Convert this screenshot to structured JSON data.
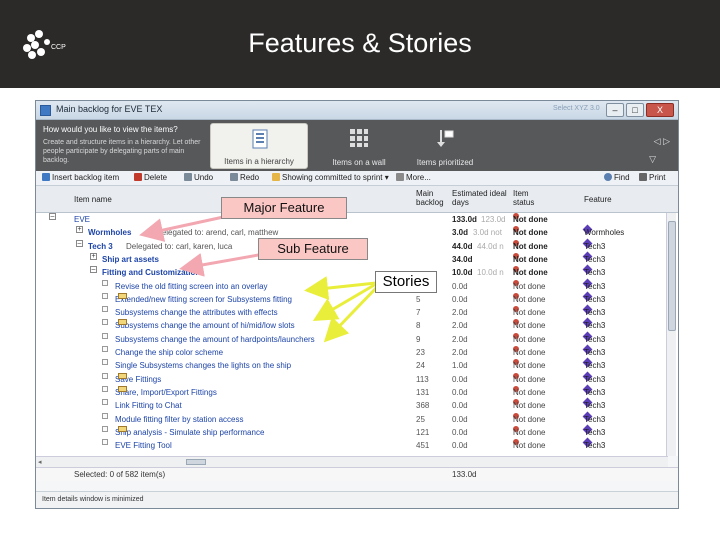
{
  "slide": {
    "title": "Features & Stories",
    "logo_text": "CCP",
    "banner_color": "#2b2a28"
  },
  "window": {
    "title": "Main backlog for EVE TEX",
    "faded_title": "Select XYZ 3.0",
    "buttons": [
      "–",
      "□",
      "X"
    ]
  },
  "view_panel": {
    "question": "How would you like to view the items?",
    "description": "Create and structure items in a hierarchy. Let other people participate by delegating parts of main backlog.",
    "options": [
      {
        "label": "Items in a hierarchy",
        "icon": "hierarchy-icon",
        "selected": true
      },
      {
        "label": "Items on a wall",
        "icon": "wall-grid-icon",
        "selected": false
      },
      {
        "label": "Items prioritized",
        "icon": "prioritized-icon",
        "selected": false
      }
    ],
    "nav": "◁ ▷",
    "more": "▽"
  },
  "toolbar": {
    "insert": "Insert backlog item",
    "delete": "Delete",
    "undo": "Undo",
    "redo": "Redo",
    "showing": "Showing committed to sprint",
    "more": "More...",
    "find": "Find",
    "print": "Print"
  },
  "columns": {
    "name": "Item name",
    "main_backlog": "Main backlog",
    "estimated": "Estimated ideal days",
    "status": "Item status",
    "feature": "Feature"
  },
  "rows": [
    {
      "toggle": "–",
      "name": "EVE",
      "num": "",
      "est": "133.0d",
      "est2": "123.0d",
      "status": "Not done",
      "feature": ""
    },
    {
      "toggle": "+",
      "name": "Wormholes",
      "note": "Delegated to: arend, carl, matthew",
      "num": "",
      "est": "3.0d",
      "est2": "3.0d not",
      "status": "Not done",
      "feature": "Wormholes"
    },
    {
      "toggle": "–",
      "name": "Tech 3",
      "note": "Delegated to: carl, karen, luca",
      "num": "",
      "est": "44.0d",
      "est2": "44.0d n",
      "status": "Not done",
      "feature": "Tech3"
    },
    {
      "toggle": "+",
      "name": "Ship art assets",
      "num": "",
      "est": "34.0d",
      "est2": "",
      "status": "Not done",
      "feature": "Tech3"
    },
    {
      "toggle": "–",
      "name": "Fitting and Customization",
      "num": "",
      "est": "10.0d",
      "est2": "10.0d n",
      "status": "Not done",
      "feature": "Tech3"
    },
    {
      "name": "Revise the old fitting screen into an overlay",
      "num": "",
      "est": "0.0d",
      "status": "Not done",
      "feature": "Tech3"
    },
    {
      "name": "Extended/new fitting screen for Subsystems fitting",
      "mail": true,
      "num": "5",
      "est": "0.0d",
      "status": "Not done",
      "feature": "Tech3"
    },
    {
      "name": "Subsystems change the attributes with effects",
      "num": "7",
      "est": "2.0d",
      "status": "Not done",
      "feature": "Tech3"
    },
    {
      "name": "Subsystems change the amount of hi/mid/low slots",
      "mail": true,
      "num": "8",
      "est": "2.0d",
      "status": "Not done",
      "feature": "Tech3"
    },
    {
      "name": "Subsystems change the amount of hardpoints/launchers",
      "num": "9",
      "est": "2.0d",
      "status": "Not done",
      "feature": "Tech3"
    },
    {
      "name": "Change the ship color scheme",
      "num": "23",
      "est": "2.0d",
      "status": "Not done",
      "feature": "Tech3"
    },
    {
      "name": "Single Subsystems changes the lights on the ship",
      "num": "24",
      "est": "1.0d",
      "status": "Not done",
      "feature": "Tech3"
    },
    {
      "name": "Save Fittings",
      "mail": true,
      "num": "113",
      "est": "0.0d",
      "status": "Not done",
      "feature": "Tech3"
    },
    {
      "name": "Share, Import/Export Fittings",
      "mail": true,
      "num": "131",
      "est": "0.0d",
      "status": "Not done",
      "feature": "Tech3"
    },
    {
      "name": "Link Fitting to Chat",
      "num": "368",
      "est": "0.0d",
      "status": "Not done",
      "feature": "Tech3"
    },
    {
      "name": "Module fitting filter by station access",
      "num": "25",
      "est": "0.0d",
      "status": "Not done",
      "feature": "Tech3"
    },
    {
      "name": "Ship analysis - Simulate ship performance",
      "mail": true,
      "num": "121",
      "est": "0.0d",
      "status": "Not done",
      "feature": "Tech3"
    },
    {
      "name": "EVE Fitting Tool",
      "num": "451",
      "est": "0.0d",
      "status": "Not done",
      "feature": "Tech3"
    }
  ],
  "summary": {
    "selected": "Selected: 0 of 582 item(s)",
    "total": "133.0d"
  },
  "statusbar": {
    "text": "Item details window is minimized"
  },
  "callouts": {
    "major": "Major Feature",
    "sub": "Sub Feature",
    "stories": "Stories"
  },
  "colors": {
    "arrow_pink": "#f2a7b1",
    "arrow_yellow": "#e9ee3a",
    "callout_pink": "#fbc7c4",
    "link_blue": "#1d44a8",
    "status_red": "#c3001b"
  }
}
